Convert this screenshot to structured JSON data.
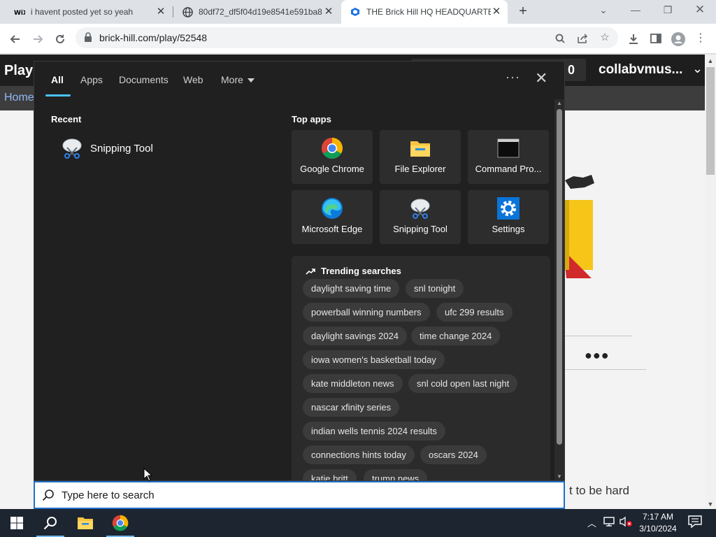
{
  "browser": {
    "tabs": [
      {
        "title": "i havent posted yet so yeah",
        "favicon": "wix-icon"
      },
      {
        "title": "80df72_df5f04d19e8541e591ba8",
        "favicon": "globe-icon"
      },
      {
        "title": "THE Brick Hill HQ HEADQUARTE",
        "favicon": "brickhill-icon"
      }
    ],
    "url": "brick-hill.com/play/52548"
  },
  "page": {
    "brand": "Play",
    "search_stub": "0",
    "username": "collabvmus...",
    "subnav_home": "Home",
    "dots": "●●●",
    "bottom_text": "t to be hard"
  },
  "search_flyout": {
    "tabs": [
      "All",
      "Apps",
      "Documents",
      "Web",
      "More"
    ],
    "recent_heading": "Recent",
    "recent_items": [
      {
        "label": "Snipping Tool",
        "icon": "snipping-tool-icon"
      }
    ],
    "top_apps_heading": "Top apps",
    "top_apps": [
      {
        "label": "Google Chrome",
        "icon": "chrome-icon"
      },
      {
        "label": "File Explorer",
        "icon": "file-explorer-icon"
      },
      {
        "label": "Command Pro...",
        "icon": "command-prompt-icon"
      },
      {
        "label": "Microsoft Edge",
        "icon": "edge-icon"
      },
      {
        "label": "Snipping Tool",
        "icon": "snipping-tool-icon"
      },
      {
        "label": "Settings",
        "icon": "settings-icon"
      }
    ],
    "trending_heading": "Trending searches",
    "trending": [
      "daylight saving time",
      "snl tonight",
      "powerball winning numbers",
      "ufc 299 results",
      "daylight savings 2024",
      "time change 2024",
      "iowa women's basketball today",
      "kate middleton news",
      "snl cold open last night",
      "nascar xfinity series",
      "indian wells tennis 2024 results",
      "connections hints today",
      "oscars 2024",
      "katie britt",
      "trump news"
    ]
  },
  "searchbox": {
    "placeholder": "Type here to search"
  },
  "taskbar": {
    "time": "7:17 AM",
    "date": "3/10/2024"
  },
  "colors": {
    "accent": "#4cc2ff",
    "flyout_bg": "#202020",
    "taskbar_bg": "#1c2530",
    "searchbox_border": "#1f6fc5"
  }
}
